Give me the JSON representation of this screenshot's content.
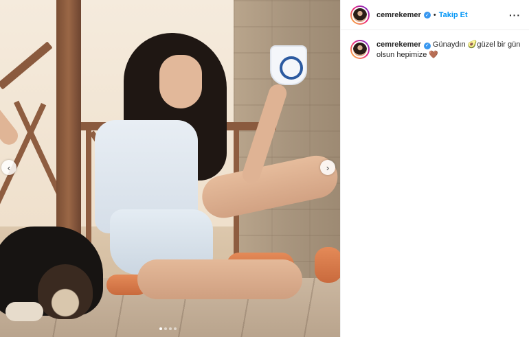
{
  "post": {
    "username": "cemrekemer",
    "separator": "•",
    "follow_label": "Takip Et",
    "more_icon": "more-horizontal-icon",
    "caption": "Günaydın 🥑güzel bir gün olsun hepimize 🤎"
  },
  "carousel": {
    "prev_glyph": "‹",
    "next_glyph": "›",
    "slides": 4,
    "active_slide": 1
  },
  "colors": {
    "accent": "#0095f6",
    "verified": "#3897f0"
  }
}
